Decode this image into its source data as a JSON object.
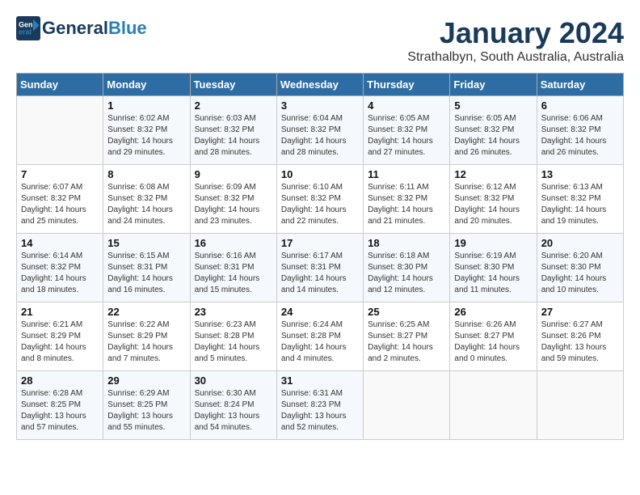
{
  "header": {
    "logo_line1": "General",
    "logo_line2": "Blue",
    "month": "January 2024",
    "location": "Strathalbyn, South Australia, Australia"
  },
  "weekdays": [
    "Sunday",
    "Monday",
    "Tuesday",
    "Wednesday",
    "Thursday",
    "Friday",
    "Saturday"
  ],
  "weeks": [
    [
      {
        "day": "",
        "info": ""
      },
      {
        "day": "1",
        "info": "Sunrise: 6:02 AM\nSunset: 8:32 PM\nDaylight: 14 hours\nand 29 minutes."
      },
      {
        "day": "2",
        "info": "Sunrise: 6:03 AM\nSunset: 8:32 PM\nDaylight: 14 hours\nand 28 minutes."
      },
      {
        "day": "3",
        "info": "Sunrise: 6:04 AM\nSunset: 8:32 PM\nDaylight: 14 hours\nand 28 minutes."
      },
      {
        "day": "4",
        "info": "Sunrise: 6:05 AM\nSunset: 8:32 PM\nDaylight: 14 hours\nand 27 minutes."
      },
      {
        "day": "5",
        "info": "Sunrise: 6:05 AM\nSunset: 8:32 PM\nDaylight: 14 hours\nand 26 minutes."
      },
      {
        "day": "6",
        "info": "Sunrise: 6:06 AM\nSunset: 8:32 PM\nDaylight: 14 hours\nand 26 minutes."
      }
    ],
    [
      {
        "day": "7",
        "info": "Sunrise: 6:07 AM\nSunset: 8:32 PM\nDaylight: 14 hours\nand 25 minutes."
      },
      {
        "day": "8",
        "info": "Sunrise: 6:08 AM\nSunset: 8:32 PM\nDaylight: 14 hours\nand 24 minutes."
      },
      {
        "day": "9",
        "info": "Sunrise: 6:09 AM\nSunset: 8:32 PM\nDaylight: 14 hours\nand 23 minutes."
      },
      {
        "day": "10",
        "info": "Sunrise: 6:10 AM\nSunset: 8:32 PM\nDaylight: 14 hours\nand 22 minutes."
      },
      {
        "day": "11",
        "info": "Sunrise: 6:11 AM\nSunset: 8:32 PM\nDaylight: 14 hours\nand 21 minutes."
      },
      {
        "day": "12",
        "info": "Sunrise: 6:12 AM\nSunset: 8:32 PM\nDaylight: 14 hours\nand 20 minutes."
      },
      {
        "day": "13",
        "info": "Sunrise: 6:13 AM\nSunset: 8:32 PM\nDaylight: 14 hours\nand 19 minutes."
      }
    ],
    [
      {
        "day": "14",
        "info": "Sunrise: 6:14 AM\nSunset: 8:32 PM\nDaylight: 14 hours\nand 18 minutes."
      },
      {
        "day": "15",
        "info": "Sunrise: 6:15 AM\nSunset: 8:31 PM\nDaylight: 14 hours\nand 16 minutes."
      },
      {
        "day": "16",
        "info": "Sunrise: 6:16 AM\nSunset: 8:31 PM\nDaylight: 14 hours\nand 15 minutes."
      },
      {
        "day": "17",
        "info": "Sunrise: 6:17 AM\nSunset: 8:31 PM\nDaylight: 14 hours\nand 14 minutes."
      },
      {
        "day": "18",
        "info": "Sunrise: 6:18 AM\nSunset: 8:30 PM\nDaylight: 14 hours\nand 12 minutes."
      },
      {
        "day": "19",
        "info": "Sunrise: 6:19 AM\nSunset: 8:30 PM\nDaylight: 14 hours\nand 11 minutes."
      },
      {
        "day": "20",
        "info": "Sunrise: 6:20 AM\nSunset: 8:30 PM\nDaylight: 14 hours\nand 10 minutes."
      }
    ],
    [
      {
        "day": "21",
        "info": "Sunrise: 6:21 AM\nSunset: 8:29 PM\nDaylight: 14 hours\nand 8 minutes."
      },
      {
        "day": "22",
        "info": "Sunrise: 6:22 AM\nSunset: 8:29 PM\nDaylight: 14 hours\nand 7 minutes."
      },
      {
        "day": "23",
        "info": "Sunrise: 6:23 AM\nSunset: 8:28 PM\nDaylight: 14 hours\nand 5 minutes."
      },
      {
        "day": "24",
        "info": "Sunrise: 6:24 AM\nSunset: 8:28 PM\nDaylight: 14 hours\nand 4 minutes."
      },
      {
        "day": "25",
        "info": "Sunrise: 6:25 AM\nSunset: 8:27 PM\nDaylight: 14 hours\nand 2 minutes."
      },
      {
        "day": "26",
        "info": "Sunrise: 6:26 AM\nSunset: 8:27 PM\nDaylight: 14 hours\nand 0 minutes."
      },
      {
        "day": "27",
        "info": "Sunrise: 6:27 AM\nSunset: 8:26 PM\nDaylight: 13 hours\nand 59 minutes."
      }
    ],
    [
      {
        "day": "28",
        "info": "Sunrise: 6:28 AM\nSunset: 8:25 PM\nDaylight: 13 hours\nand 57 minutes."
      },
      {
        "day": "29",
        "info": "Sunrise: 6:29 AM\nSunset: 8:25 PM\nDaylight: 13 hours\nand 55 minutes."
      },
      {
        "day": "30",
        "info": "Sunrise: 6:30 AM\nSunset: 8:24 PM\nDaylight: 13 hours\nand 54 minutes."
      },
      {
        "day": "31",
        "info": "Sunrise: 6:31 AM\nSunset: 8:23 PM\nDaylight: 13 hours\nand 52 minutes."
      },
      {
        "day": "",
        "info": ""
      },
      {
        "day": "",
        "info": ""
      },
      {
        "day": "",
        "info": ""
      }
    ]
  ]
}
